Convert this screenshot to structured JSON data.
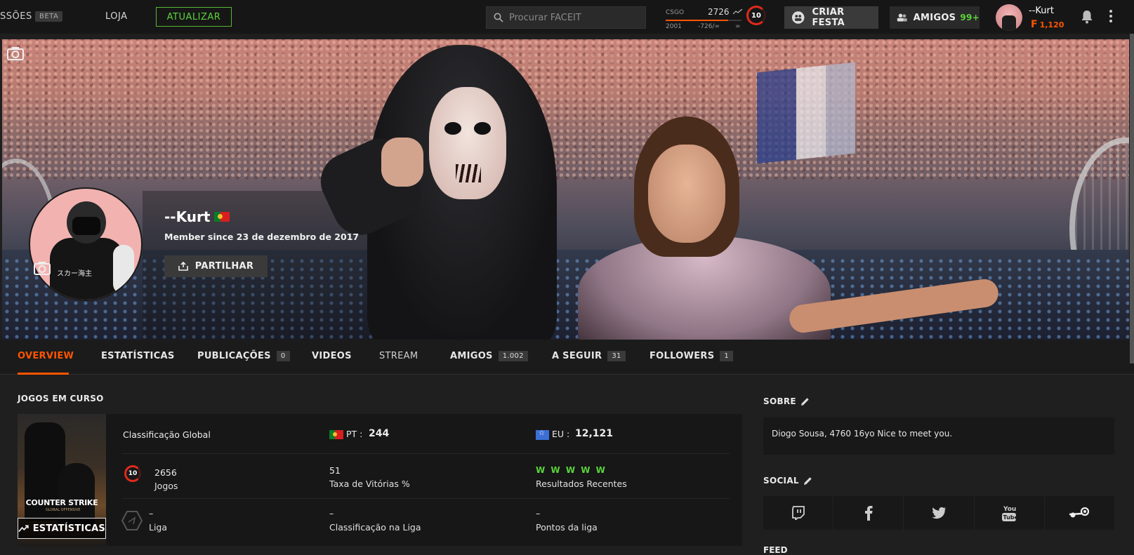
{
  "topbar": {
    "brand_truncated": "SSÕES",
    "beta_label": "BETA",
    "loja_label": "LOJA",
    "upgrade_label": "ATUALIZAR",
    "search_placeholder": "Procurar FACEIT",
    "elo": {
      "game": "CSGO",
      "value": "2726",
      "min": "2001",
      "diff": "-726/∞",
      "max": "∞",
      "progress": 0.82
    },
    "level": "10",
    "party_label": "CRIAR FESTA",
    "friends_label": "AMIGOS",
    "friends_count": "99+",
    "user_name": "--Kurt",
    "user_points_icon": "F",
    "user_points": "1,120"
  },
  "profile": {
    "name": "--Kurt",
    "member_since": "Member since 23 de dezembro de 2017",
    "share_label": "PARTILHAR"
  },
  "tabs": [
    {
      "label": "OVERVIEW"
    },
    {
      "label": "ESTATÍSTICAS"
    },
    {
      "label": "PUBLICAÇÕES",
      "badge": "0"
    },
    {
      "label": "VIDEOS"
    },
    {
      "label": "STREAM"
    },
    {
      "label": "AMIGOS",
      "badge": "1.002"
    },
    {
      "label": "A SEGUIR",
      "badge": "31"
    },
    {
      "label": "FOLLOWERS",
      "badge": "1"
    }
  ],
  "games": {
    "title": "JOGOS EM CURSO",
    "cover_logo": "COUNTER STRIKE",
    "cover_sub": "GLOBAL OFFENSIVE",
    "stats_button": "ESTATÍSTICAS",
    "global_ranking_label": "Classificação Global",
    "pt_label": "PT :",
    "pt_value": "244",
    "eu_label": "EU :",
    "eu_value": "12,121",
    "level": "10",
    "matches_value": "2656",
    "matches_label": "Jogos",
    "winrate_value": "51",
    "winrate_label": "Taxa de Vitórias %",
    "recent_results": "W W W W W",
    "recent_label": "Resultados Recentes",
    "league_value": "–",
    "league_label": "Liga",
    "league_rank_value": "–",
    "league_rank_label": "Classificação na Liga",
    "league_points_value": "–",
    "league_points_label": "Pontos da liga"
  },
  "sidebar": {
    "about_title": "SOBRE",
    "about_text": "Diogo Sousa, 4760 16yo Nice to meet you.",
    "social_title": "SOCIAL",
    "feed_title": "FEED"
  },
  "colors": {
    "accent": "#ff5500",
    "green": "#5bd33c",
    "level_red": "#e02a1b"
  }
}
